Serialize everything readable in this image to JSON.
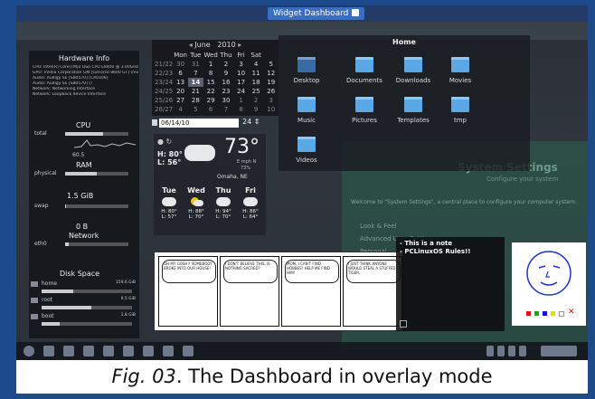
{
  "window": {
    "title": "Widget Dashboard"
  },
  "hardware": {
    "title": "Hardware Info",
    "cpu_lines": [
      "CPU:  Intel(R) Core(TM)2 Duo CPU E8400 @ 3.00GHz",
      "GPU:  nVidia Corporation GM [GeForce 8600 GT] (rev a1)",
      "Audio: Audigy SE [SB0570] [CA0106]",
      "Audio: Audigy SE [SB0570] ()",
      "Network: Networking Interface",
      "Network: Loopback device Interface"
    ],
    "cpu_label": "CPU",
    "total_label": "total",
    "cpu_value": "60.5",
    "ram_label": "RAM",
    "physical_label": "physical",
    "ram_value": "1.5 GiB",
    "swap_label": "swap",
    "swap_value": "0 B",
    "network_label": "Network",
    "eth_label": "eth0",
    "disk_label": "Disk Space",
    "disks": [
      {
        "name": "home",
        "size": "159.6 GiB",
        "fill": 0.35
      },
      {
        "name": "root",
        "size": "9.5 GiB",
        "fill": 0.55
      },
      {
        "name": "boot",
        "size": "1.8 GiB",
        "fill": 0.2
      }
    ]
  },
  "calendar": {
    "month": "June",
    "year": "2010",
    "weekdays": [
      "Mon",
      "Tue",
      "Wed",
      "Thu",
      "Fri",
      "Sat"
    ],
    "rows": [
      [
        "21/22",
        "30",
        "31",
        "1",
        "2",
        "3",
        "4",
        "5"
      ],
      [
        "22/23",
        "6",
        "7",
        "8",
        "9",
        "10",
        "11",
        "12"
      ],
      [
        "23/24",
        "13",
        "14",
        "15",
        "16",
        "17",
        "18",
        "19"
      ],
      [
        "24/25",
        "20",
        "21",
        "22",
        "23",
        "24",
        "25",
        "26"
      ],
      [
        "25/26",
        "27",
        "28",
        "29",
        "30",
        "1",
        "2",
        "3"
      ],
      [
        "26/27",
        "4",
        "5",
        "6",
        "7",
        "8",
        "9",
        "10"
      ]
    ],
    "today": "14",
    "date_input": "06/14/10",
    "time_value": "24"
  },
  "weather": {
    "temp": "73°",
    "high": "H: 80°",
    "low": "L: 56°",
    "wind": "E mph N",
    "humidity": "73%",
    "location": "Omaha, NE",
    "days": [
      {
        "day": "Tue",
        "high": "H: 80°",
        "low": "L: 57°"
      },
      {
        "day": "Wed",
        "high": "H: 88°",
        "low": "L: 70°"
      },
      {
        "day": "Thu",
        "high": "H: 94°",
        "low": "L: 70°"
      },
      {
        "day": "Fri",
        "high": "H: 86°",
        "low": "L: 64°"
      }
    ]
  },
  "folder": {
    "title": "Home",
    "items": [
      "Desktop",
      "Documents",
      "Downloads",
      "Movies",
      "Music",
      "Pictures",
      "Templates",
      "tmp",
      "Videos"
    ]
  },
  "settings": {
    "title": "System Settings",
    "subtitle": "Configure your system",
    "welcome": "Welcome to \"System Settings\", a central place to configure your computer system.",
    "items": [
      "Look & Feel",
      "Advanced User Settings",
      "Personal"
    ]
  },
  "note": {
    "line1": "- This is a note",
    "line2": "- PCLinuxOS Rules!!"
  },
  "drawing": {
    "swatches": [
      "#d11",
      "#1a1",
      "#11c",
      "#dd1",
      "#fff"
    ]
  },
  "comic": {
    "panels": [
      "OH MY GOSH!! SOMEBODY BROKE INTO OUR HOUSE!",
      "I DON'T BELIEVE THIS. IS NOTHING SACRED?",
      "MOM, I CAN'T FIND HOBBES! HELP ME FIND HIM!",
      "I JUST THINK ANYONE WOULD STEAL A STUFFED TIGER."
    ]
  },
  "caption": {
    "prefix": "Fig. 03",
    "text": ". The Dashboard in overlay mode"
  }
}
